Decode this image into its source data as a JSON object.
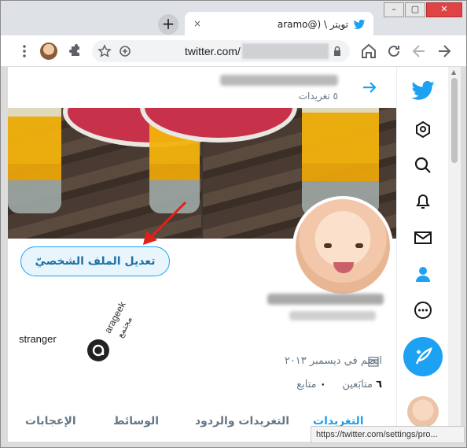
{
  "browser": {
    "tab_title": "تويتر \\ (@aramo",
    "tab_close": "×",
    "new_tab": "+",
    "url": "twitter.com/",
    "status_url": "https://twitter.com/settings/pro..."
  },
  "toolbar_icons": [
    "back-arrow-icon",
    "forward-arrow-icon",
    "reload-icon",
    "home-icon",
    "lock-icon",
    "add-bookmark-icon",
    "star-icon",
    "extensions-icon",
    "menu-icon"
  ],
  "profile": {
    "tweet_count": "٥ تغريدات",
    "edit_button": "تعديل الملف الشخصيّ",
    "bio": "stranger",
    "joined": "انضم في ديسمبر ٢٠١٣",
    "following_count": "٦",
    "following_label": "متابَعين",
    "followers_count": "٠",
    "followers_label": "متابع"
  },
  "watermark": {
    "latin": "arageek",
    "arabic": "مجتمع"
  },
  "tabs": [
    {
      "label": "التغريدات",
      "active": true
    },
    {
      "label": "التغريدات والردود",
      "active": false
    },
    {
      "label": "الوسائط",
      "active": false
    },
    {
      "label": "الإعجابات",
      "active": false
    }
  ],
  "colors": {
    "twitter_blue": "#1da1f2",
    "annotation_red": "#e0201b"
  }
}
